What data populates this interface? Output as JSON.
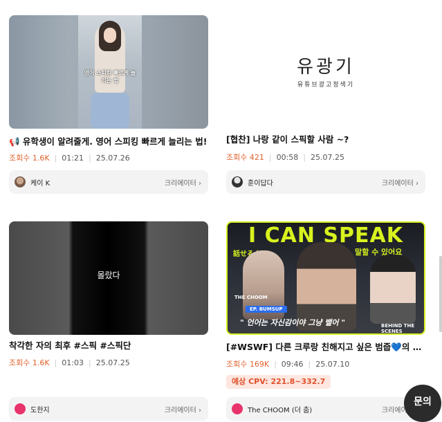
{
  "cards": [
    {
      "title": "📢 유학생이 알려줄게. 영어 스피킹 빠르게 늘리는 법!",
      "views": "조회수 1.6K",
      "duration": "01:21",
      "date": "25.07.26",
      "creator": "케이 K",
      "creator_link": "크리에이터 ›",
      "thumb_caption": "영어 스피킹 빠르게 늘리는 법"
    },
    {
      "title": "[협찬] 나랑 같이 스픽할 사람 ~?",
      "views": "조회수 421",
      "duration": "00:58",
      "date": "25.07.25",
      "creator": "훈이답다",
      "creator_link": "크리에이터 ›",
      "thumb_title": "유광기",
      "thumb_subtitle": "유튜브광고정색기"
    },
    {
      "title": "착각한 자의 최후 #스픽 #스픽단",
      "views": "조회수 1.6K",
      "duration": "01:03",
      "date": "25.07.25",
      "creator": "도한지",
      "creator_link": "크리에이터 ›",
      "thumb_caption": "몰랐다"
    },
    {
      "title": "[#WSWF] 다른 크루랑 친해지고 싶은 범줍💙의 비장...",
      "views": "조회수 169K",
      "duration": "09:46",
      "date": "25.07.10",
      "creator": "The CHOOM (더 춤)",
      "creator_link": "크리에이터 ›",
      "cpv": "예상 CPV: 221.8~332.7",
      "thumb_banner": "I CAN SPEAK",
      "thumb_sub_a": "話せるよ",
      "thumb_sub_b": "말할 수 있어요",
      "thumb_ep": "EP. BUMSUP",
      "thumb_quote": "\" 언어는 자신감이야 그냥 뱉어 \"",
      "thumb_bts": "BEHIND THE SCENES",
      "thumb_logo": "THE CHOOM"
    }
  ],
  "inquiry_label": "문의",
  "colors": {
    "accent": "#e0602b",
    "cpv_bg": "#fde7e0",
    "creator_bar": "#f3f3f3",
    "fab": "#2b2b2b"
  }
}
